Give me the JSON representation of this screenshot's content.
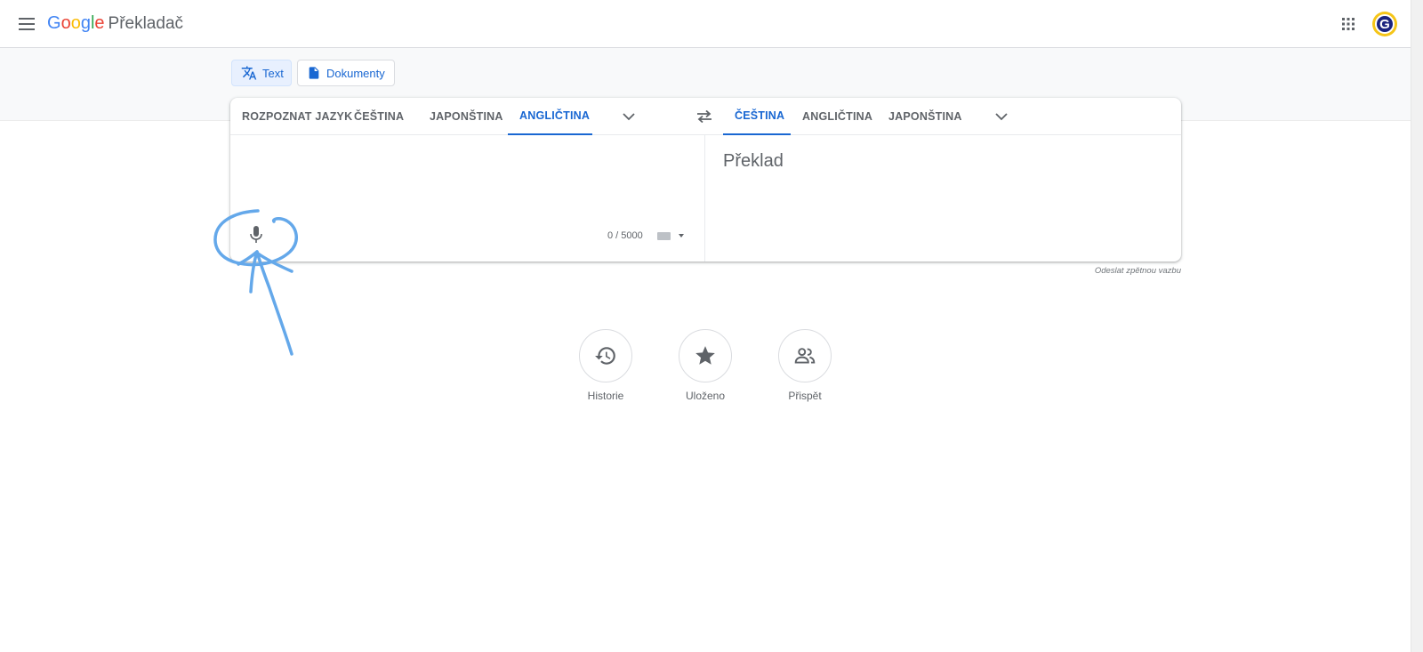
{
  "header": {
    "logo_letters": [
      "G",
      "o",
      "o",
      "g",
      "l",
      "e"
    ],
    "product_name": "Překladač",
    "menu_icon": "hamburger-menu-icon",
    "apps_icon": "apps-grid-icon",
    "avatar_letter": "G"
  },
  "modes": [
    {
      "label": "Text",
      "icon": "translate-icon",
      "active": true
    },
    {
      "label": "Dokumenty",
      "icon": "document-icon",
      "active": false
    }
  ],
  "source_languages": [
    {
      "label": "ROZPOZNAT JAZYK",
      "selected": false
    },
    {
      "label": "ČEŠTINA",
      "selected": false
    },
    {
      "label": "JAPONŠTINA",
      "selected": false
    },
    {
      "label": "ANGLIČTINA",
      "selected": true
    }
  ],
  "target_languages": [
    {
      "label": "ČEŠTINA",
      "selected": true
    },
    {
      "label": "ANGLIČTINA",
      "selected": false
    },
    {
      "label": "JAPONŠTINA",
      "selected": false
    }
  ],
  "source": {
    "value": "",
    "char_count": "0 / 5000",
    "mic_icon": "microphone-icon",
    "keyboard_icon": "keyboard-icon"
  },
  "target": {
    "placeholder": "Překlad"
  },
  "feedback_link": "Odeslat zpětnou vazbu",
  "quick_actions": [
    {
      "label": "Historie",
      "icon": "history-icon"
    },
    {
      "label": "Uloženo",
      "icon": "star-icon"
    },
    {
      "label": "Přispět",
      "icon": "people-icon"
    }
  ],
  "colors": {
    "accent": "#1967d2",
    "annotation": "#64a8ea"
  }
}
